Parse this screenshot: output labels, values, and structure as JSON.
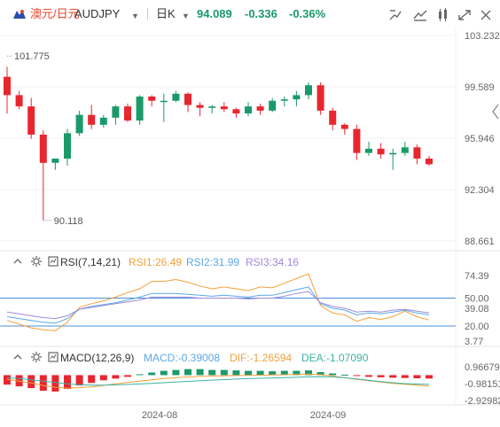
{
  "header": {
    "pair_cn": "澳元/日元",
    "pair_code": "AUDJPY",
    "timeframe": "日K",
    "price": "94.089",
    "change": "-0.336",
    "change_pct": "-0.36%",
    "dropdown_glyph": "▼"
  },
  "toolbar": {
    "icons": [
      "bar-settings-icon",
      "indicator-icon",
      "draw-icon",
      "alert-icon",
      "fullscreen-icon",
      "close-icon"
    ]
  },
  "colors": {
    "up": "#1a9a6a",
    "down": "#e8262f",
    "rsi1": "#f2a03d",
    "rsi2": "#5aa8e8",
    "rsi3": "#a08ad8",
    "macd_line": "#5aa8e8",
    "dif": "#f2a03d",
    "dea": "#3bb3a6",
    "ref_line": "#4a90d9"
  },
  "panels": {
    "rsi_label": "RSI(7,14,21)",
    "rsi1": "RSI1:26.49",
    "rsi2": "RSI2:31.99",
    "rsi3": "RSI3:34.16",
    "macd_label": "MACD(12,26,9)",
    "macd": "MACD:-0.39008",
    "dif": "DIF:-1.26594",
    "dea": "DEA:-1.07090"
  },
  "chart_data": [
    {
      "type": "candlestick",
      "y_ticks": [
        "103.232",
        "99.589",
        "95.946",
        "92.304",
        "88.661"
      ],
      "ylim": [
        88.661,
        103.232
      ],
      "annotations": {
        "high": "101.775",
        "low": "90.118"
      },
      "x_ticks": [
        "2024-08",
        "2024-09"
      ],
      "candles": [
        [
          100.3,
          101.0,
          97.7,
          99.0
        ],
        [
          99.0,
          99.3,
          98.0,
          98.2
        ],
        [
          98.2,
          98.8,
          95.9,
          96.2
        ],
        [
          96.2,
          96.5,
          90.118,
          94.2
        ],
        [
          94.2,
          94.5,
          93.7,
          94.5
        ],
        [
          94.5,
          96.6,
          94.0,
          96.3
        ],
        [
          96.3,
          97.9,
          96.1,
          97.6
        ],
        [
          97.6,
          98.3,
          96.6,
          96.9
        ],
        [
          96.9,
          97.6,
          96.7,
          97.4
        ],
        [
          97.4,
          98.3,
          96.9,
          98.2
        ],
        [
          98.2,
          98.4,
          97.1,
          97.2
        ],
        [
          97.2,
          99.0,
          96.9,
          98.9
        ],
        [
          98.9,
          99.0,
          98.2,
          98.6
        ],
        [
          98.6,
          99.1,
          97.1,
          98.6
        ],
        [
          98.6,
          99.3,
          98.5,
          99.1
        ],
        [
          99.1,
          99.2,
          97.8,
          98.3
        ],
        [
          98.3,
          98.5,
          97.5,
          98.1
        ],
        [
          98.1,
          98.3,
          97.7,
          98.2
        ],
        [
          98.2,
          98.5,
          97.8,
          98.0
        ],
        [
          98.0,
          98.1,
          97.4,
          97.7
        ],
        [
          97.7,
          98.5,
          97.5,
          98.2
        ],
        [
          98.2,
          98.4,
          97.6,
          97.9
        ],
        [
          97.9,
          98.8,
          97.8,
          98.6
        ],
        [
          98.6,
          98.9,
          98.2,
          98.7
        ],
        [
          98.7,
          99.3,
          98.2,
          99.0
        ],
        [
          99.0,
          99.9,
          98.7,
          99.7
        ],
        [
          99.7,
          99.9,
          97.6,
          97.9
        ],
        [
          97.9,
          98.1,
          96.5,
          96.9
        ],
        [
          96.9,
          97.0,
          96.2,
          96.6
        ],
        [
          96.6,
          96.9,
          94.4,
          94.9
        ],
        [
          94.9,
          95.7,
          94.7,
          95.2
        ],
        [
          95.2,
          95.6,
          94.5,
          94.8
        ],
        [
          94.8,
          95.2,
          93.7,
          94.9
        ],
        [
          94.9,
          95.7,
          94.7,
          95.3
        ],
        [
          95.3,
          95.5,
          94.1,
          94.5
        ],
        [
          94.5,
          94.7,
          94.0,
          94.1
        ]
      ]
    },
    {
      "type": "line",
      "y_ticks": [
        "74.39",
        "50.00",
        "39.08",
        "20.00",
        "3.77"
      ],
      "ylim": [
        3.77,
        80
      ],
      "ref_lines": [
        50,
        20
      ],
      "series": [
        {
          "name": "RSI1",
          "values": [
            26,
            22,
            18,
            16,
            15,
            24,
            40,
            44,
            47,
            51,
            56,
            60,
            68,
            68,
            70,
            67,
            63,
            60,
            62,
            60,
            58,
            62,
            61,
            66,
            71,
            76,
            42,
            34,
            32,
            25,
            29,
            27,
            30,
            36,
            30,
            26.49
          ]
        },
        {
          "name": "RSI2",
          "values": [
            30,
            28,
            26,
            24,
            23,
            28,
            38,
            41,
            43,
            45,
            48,
            51,
            55,
            55,
            55,
            54,
            53,
            52,
            53,
            52,
            51,
            53,
            53,
            56,
            59,
            62,
            44,
            39,
            37,
            32,
            34,
            33,
            35,
            37,
            34,
            31.99
          ]
        },
        {
          "name": "RSI3",
          "values": [
            35,
            33,
            31,
            29,
            28,
            31,
            38,
            40,
            42,
            44,
            46,
            48,
            51,
            51,
            51,
            51,
            50,
            50,
            50,
            50,
            49,
            50,
            50,
            52,
            55,
            57,
            45,
            41,
            39,
            35,
            36,
            35,
            37,
            38,
            36,
            34.16
          ]
        }
      ]
    },
    {
      "type": "bar",
      "y_ticks": [
        "0.96679",
        "-0.98151",
        "-2.92982"
      ],
      "ylim": [
        -2.93,
        0.97
      ],
      "series": [
        {
          "name": "MACD",
          "values": [
            -1.1,
            -1.3,
            -1.5,
            -1.8,
            -1.9,
            -1.6,
            -1.2,
            -0.9,
            -0.6,
            -0.4,
            -0.2,
            0.1,
            0.3,
            0.5,
            0.6,
            0.7,
            0.7,
            0.6,
            0.6,
            0.55,
            0.5,
            0.5,
            0.45,
            0.5,
            0.5,
            0.55,
            0.35,
            0.2,
            0.05,
            -0.1,
            -0.2,
            -0.25,
            -0.3,
            -0.33,
            -0.36,
            -0.39008
          ]
        },
        {
          "name": "DIF",
          "values": [
            -0.5,
            -0.7,
            -0.9,
            -1.2,
            -1.4,
            -1.5,
            -1.45,
            -1.35,
            -1.2,
            -1.0,
            -0.85,
            -0.7,
            -0.55,
            -0.4,
            -0.3,
            -0.2,
            -0.15,
            -0.1,
            -0.08,
            -0.05,
            -0.03,
            0.0,
            0.02,
            0.05,
            0.08,
            0.12,
            0.05,
            -0.1,
            -0.3,
            -0.5,
            -0.65,
            -0.8,
            -0.95,
            -1.05,
            -1.15,
            -1.26594
          ]
        },
        {
          "name": "DEA",
          "values": [
            -0.3,
            -0.4,
            -0.55,
            -0.7,
            -0.85,
            -1.0,
            -1.1,
            -1.15,
            -1.15,
            -1.12,
            -1.08,
            -1.02,
            -0.95,
            -0.88,
            -0.8,
            -0.72,
            -0.65,
            -0.58,
            -0.52,
            -0.46,
            -0.41,
            -0.36,
            -0.32,
            -0.28,
            -0.25,
            -0.2,
            -0.18,
            -0.2,
            -0.3,
            -0.45,
            -0.6,
            -0.75,
            -0.88,
            -0.98,
            -1.03,
            -1.0709
          ]
        }
      ]
    }
  ]
}
